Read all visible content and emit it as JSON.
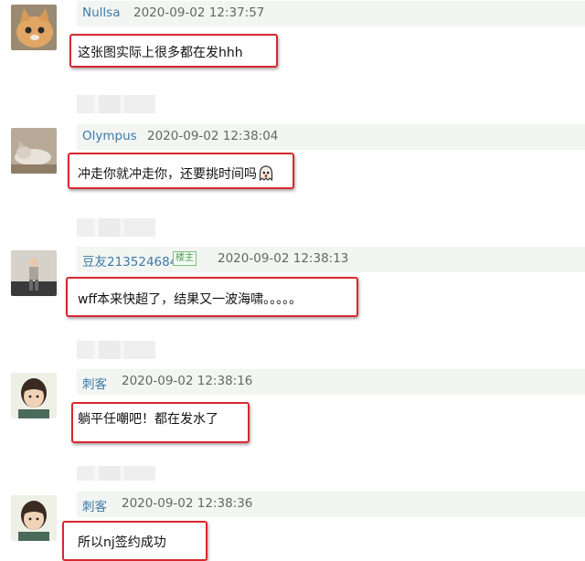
{
  "comments": [
    {
      "username": "Nullsa",
      "time": "2020-09-02 12:37:57",
      "text": "这张图实际上很多都在发hhh",
      "badge": ""
    },
    {
      "username": "Olympus",
      "time": "2020-09-02 12:38:04",
      "text": "冲走你就冲走你，还要挑时间吗",
      "badge": ""
    },
    {
      "username": "豆友213524684",
      "time": "2020-09-02 12:38:13",
      "text": "wff本来快超了，结果又一波海啸。。。。。",
      "badge": "楼主"
    },
    {
      "username": "刺客",
      "time": "2020-09-02 12:38:16",
      "text": "躺平任嘲吧！都在发水了",
      "badge": ""
    },
    {
      "username": "刺客",
      "time": "2020-09-02 12:38:36",
      "text": "所以nj签约成功",
      "badge": ""
    }
  ],
  "colors": {
    "highlight": "#d7282f",
    "username": "#3e7aa6",
    "meta_bg": "#f2f5f2"
  },
  "icons": [
    "ghost-emoji-icon"
  ]
}
